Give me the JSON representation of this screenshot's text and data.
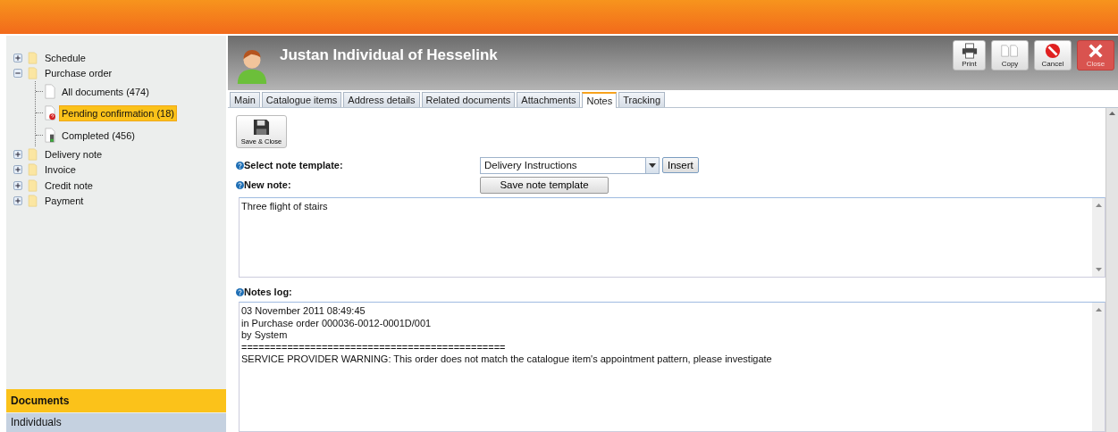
{
  "tree": [
    {
      "label": "Schedule",
      "kind": "folder",
      "expanded": false,
      "selected": false
    },
    {
      "label": "Purchase order",
      "kind": "folder",
      "expanded": true,
      "selected": false,
      "children": [
        {
          "label": "All documents (474)",
          "kind": "document",
          "selected": false
        },
        {
          "label": "Pending confirmation (18)",
          "kind": "pending",
          "selected": true
        },
        {
          "label": "Completed (456)",
          "kind": "completed",
          "selected": false
        }
      ]
    },
    {
      "label": "Delivery note",
      "kind": "folder",
      "expanded": false,
      "selected": false
    },
    {
      "label": "Invoice",
      "kind": "folder",
      "expanded": false,
      "selected": false
    },
    {
      "label": "Credit note",
      "kind": "folder",
      "expanded": false,
      "selected": false
    },
    {
      "label": "Payment",
      "kind": "folder",
      "expanded": false,
      "selected": false
    }
  ],
  "nav": [
    {
      "label": "Documents",
      "selected": true
    },
    {
      "label": "Individuals",
      "selected": false
    }
  ],
  "header": {
    "title": "Justan Individual of Hesselink"
  },
  "toolbar": [
    {
      "label": "Print",
      "kind": "print"
    },
    {
      "label": "Copy",
      "kind": "copy"
    },
    {
      "label": "Cancel",
      "kind": "cancel"
    },
    {
      "label": "Close",
      "kind": "close"
    }
  ],
  "tabs": [
    {
      "label": "Main",
      "selected": false
    },
    {
      "label": "Catalogue items",
      "selected": false
    },
    {
      "label": "Address details",
      "selected": false
    },
    {
      "label": "Related documents",
      "selected": false
    },
    {
      "label": "Attachments",
      "selected": false
    },
    {
      "label": "Notes",
      "selected": true
    },
    {
      "label": "Tracking",
      "selected": false
    }
  ],
  "save_button": {
    "label": "Save & Close"
  },
  "template": {
    "label": "Select note template:",
    "value": "Delivery Instructions",
    "insert": "Insert"
  },
  "new_note": {
    "label": "New note:",
    "button": "Save note template",
    "value": "Three flight of stairs"
  },
  "log": {
    "label": "Notes log:",
    "lines": [
      "03 November 2011 08:49:45",
      "in Purchase order 000036-0012-0001D/001",
      "by System",
      "==============================================",
      "SERVICE PROVIDER WARNING: This order does not match the catalogue item's appointment pattern, please investigate"
    ]
  }
}
